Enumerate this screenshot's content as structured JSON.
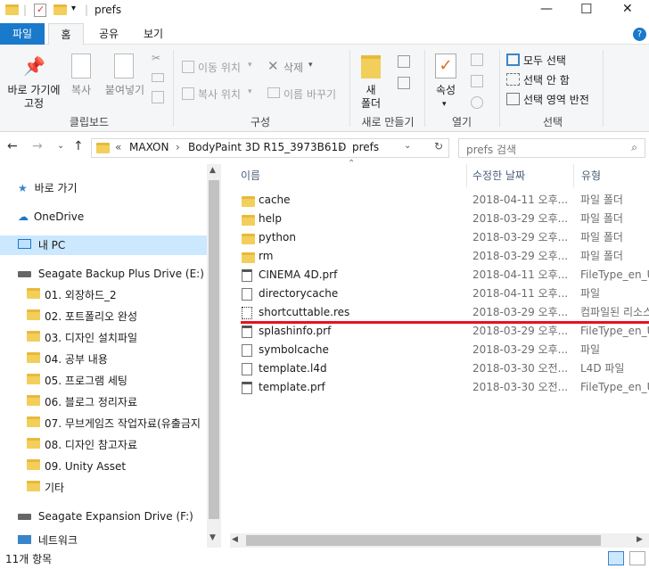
{
  "title": {
    "text": "prefs"
  },
  "window_controls": {
    "minimize": "—",
    "maximize": "☐",
    "close": "✕"
  },
  "tabs": [
    {
      "label": "파일"
    },
    {
      "label": "홈"
    },
    {
      "label": "공유"
    },
    {
      "label": "보기"
    }
  ],
  "ribbon": {
    "pin_label_1": "바로 가기에",
    "pin_label_2": "고정",
    "copy_label": "복사",
    "paste_label": "붙여넣기",
    "clipboard_group": "클립보드",
    "move_to": "이동 위치",
    "copy_to": "복사 위치",
    "delete": "삭제",
    "rename": "이름 바꾸기",
    "organize_group": "구성",
    "new_folder_1": "새",
    "new_folder_2": "폴더",
    "new_group": "새로 만들기",
    "properties": "속성",
    "open_group": "열기",
    "select_all": "모두 선택",
    "select_none": "선택 안 함",
    "invert_selection": "선택 영역 반전",
    "select_group": "선택"
  },
  "address": {
    "chevrons": "«",
    "crumbs": [
      "MAXON",
      "BodyPaint 3D R15_3973B61D",
      "prefs"
    ],
    "search_placeholder": "prefs 검색"
  },
  "nav": {
    "quick_access": "바로 가기",
    "onedrive": "OneDrive",
    "this_pc": "내 PC",
    "drive_e": "Seagate Backup Plus Drive (E:)",
    "folders": [
      "01. 외장하드_2",
      "02. 포트폴리오 완성",
      "03. 디자인 설치파일",
      "04. 공부 내용",
      "05. 프로그램 세팅",
      "06. 블로그 정리자료",
      "07. 무브게임즈 작업자료(유출금지",
      "08. 디자인 참고자료",
      "09. Unity Asset",
      "기타"
    ],
    "drive_f": "Seagate Expansion Drive (F:)",
    "network": "네트워크"
  },
  "columns": {
    "name": "이름",
    "date": "수정한 날짜",
    "type": "유형"
  },
  "files": [
    {
      "name": "cache",
      "date": "2018-04-11 오후...",
      "type": "파일 폴더",
      "kind": "folder"
    },
    {
      "name": "help",
      "date": "2018-03-29 오후...",
      "type": "파일 폴더",
      "kind": "folder"
    },
    {
      "name": "python",
      "date": "2018-03-29 오후...",
      "type": "파일 폴더",
      "kind": "folder"
    },
    {
      "name": "rm",
      "date": "2018-03-29 오후...",
      "type": "파일 폴더",
      "kind": "folder"
    },
    {
      "name": "CINEMA 4D.prf",
      "date": "2018-04-11 오후...",
      "type": "FileType_en_US",
      "kind": "file"
    },
    {
      "name": "directorycache",
      "date": "2018-04-11 오후...",
      "type": "파일",
      "kind": "file"
    },
    {
      "name": "shortcuttable.res",
      "date": "2018-03-29 오후...",
      "type": "컴파일된 리소스",
      "kind": "res"
    },
    {
      "name": "splashinfo.prf",
      "date": "2018-03-29 오후...",
      "type": "FileType_en_US",
      "kind": "file"
    },
    {
      "name": "symbolcache",
      "date": "2018-03-29 오후...",
      "type": "파일",
      "kind": "file"
    },
    {
      "name": "template.l4d",
      "date": "2018-03-30 오전...",
      "type": "L4D 파일",
      "kind": "file"
    },
    {
      "name": "template.prf",
      "date": "2018-03-30 오전...",
      "type": "FileType_en_US",
      "kind": "file"
    }
  ],
  "status": {
    "count": "11개 항목"
  },
  "colors": {
    "accent": "#1979ca",
    "highlight_line": "#e81123",
    "folder": "#f2cf5b"
  }
}
